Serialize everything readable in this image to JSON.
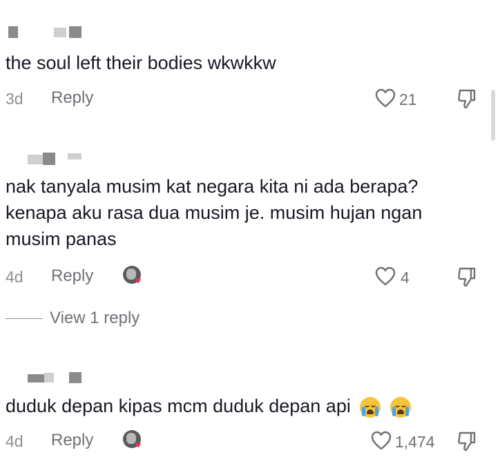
{
  "comments": [
    {
      "text": "the soul left their bodies wkwkkw",
      "time": "3d",
      "reply_label": "Reply",
      "likes": "21",
      "creator_liked": false
    },
    {
      "text": "nak tanyala musim kat negara kita ni ada berapa? kenapa aku rasa dua musim je. musim hujan ngan musim panas",
      "time": "4d",
      "reply_label": "Reply",
      "likes": "4",
      "creator_liked": true,
      "view_replies": "View 1 reply"
    },
    {
      "text": "duduk depan kipas mcm duduk depan api",
      "emojis": [
        "loudly-crying-face",
        "loudly-crying-face"
      ],
      "time": "4d",
      "reply_label": "Reply",
      "likes": "1,474",
      "creator_liked": true
    }
  ],
  "icons": {
    "like": "heart-outline-icon",
    "dislike": "thumbs-down-icon",
    "creator_like": "creator-avatar-heart-icon"
  },
  "colors": {
    "text": "#161823",
    "secondary": "#6f7076",
    "heart": "#fe2c55"
  }
}
